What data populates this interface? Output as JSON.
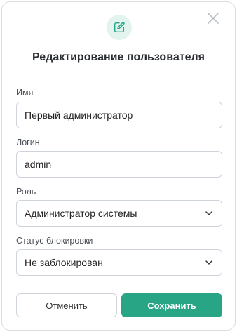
{
  "dialog": {
    "title": "Редактирование пользователя",
    "icons": {
      "header": "edit-icon",
      "close": "close-icon",
      "chevron": "chevron-down-icon"
    },
    "accent_color": "#27a585"
  },
  "form": {
    "name": {
      "label": "Имя",
      "value": "Первый администратор"
    },
    "login": {
      "label": "Логин",
      "value": "admin"
    },
    "role": {
      "label": "Роль",
      "value": "Администратор системы"
    },
    "block_status": {
      "label": "Статус блокировки",
      "value": "Не заблокирован"
    }
  },
  "actions": {
    "cancel_label": "Отменить",
    "save_label": "Сохранить"
  }
}
